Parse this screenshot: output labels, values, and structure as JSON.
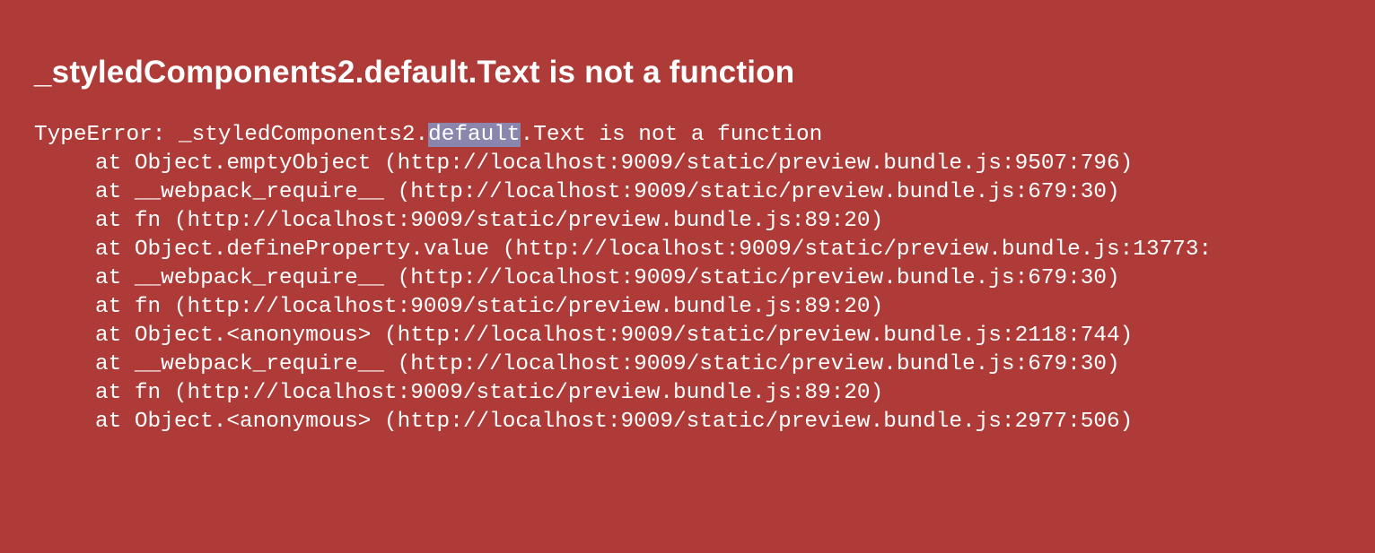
{
  "colors": {
    "background": "#ae3b37",
    "text": "#ffffff",
    "selection": "#8a86ae"
  },
  "error": {
    "title": "_styledComponents2.default.Text is not a function",
    "message": {
      "prefix": "TypeError: _styledComponents2.",
      "selected": "default",
      "suffix": ".Text is not a function"
    },
    "stack": [
      "at Object.emptyObject (http://localhost:9009/static/preview.bundle.js:9507:796)",
      "at __webpack_require__ (http://localhost:9009/static/preview.bundle.js:679:30)",
      "at fn (http://localhost:9009/static/preview.bundle.js:89:20)",
      "at Object.defineProperty.value (http://localhost:9009/static/preview.bundle.js:13773:",
      "at __webpack_require__ (http://localhost:9009/static/preview.bundle.js:679:30)",
      "at fn (http://localhost:9009/static/preview.bundle.js:89:20)",
      "at Object.<anonymous> (http://localhost:9009/static/preview.bundle.js:2118:744)",
      "at __webpack_require__ (http://localhost:9009/static/preview.bundle.js:679:30)",
      "at fn (http://localhost:9009/static/preview.bundle.js:89:20)",
      "at Object.<anonymous> (http://localhost:9009/static/preview.bundle.js:2977:506)"
    ]
  }
}
